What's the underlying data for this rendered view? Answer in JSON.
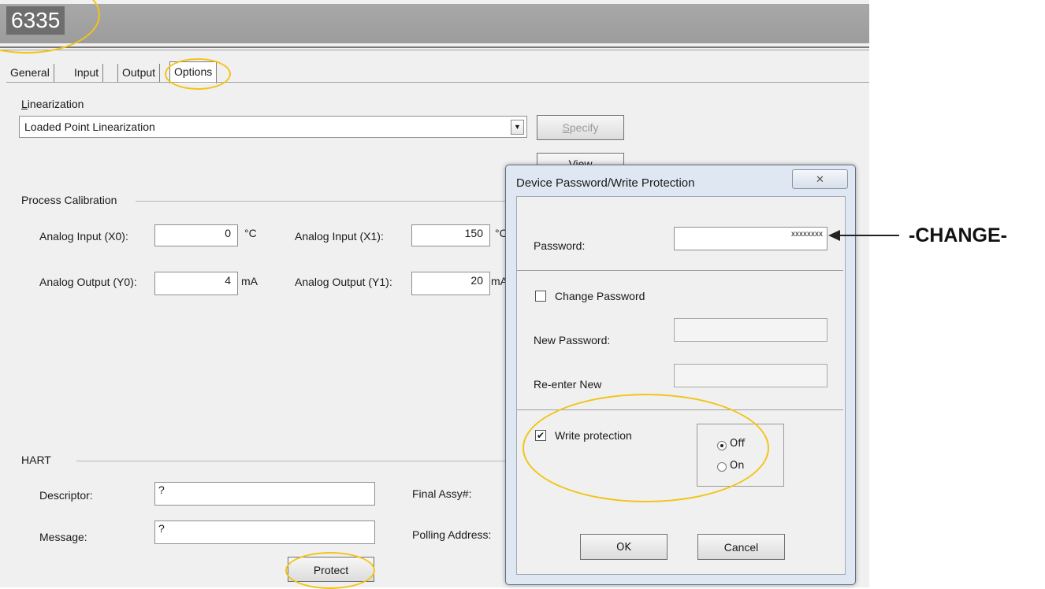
{
  "window": {
    "title": "6335"
  },
  "tabs": [
    {
      "label": "General"
    },
    {
      "label": "Input"
    },
    {
      "label": "Output"
    },
    {
      "label": "Options",
      "active": true
    }
  ],
  "linearization": {
    "label": "Linearization",
    "selected": "Loaded Point Linearization",
    "specify_label": "Specify",
    "view_label": "View"
  },
  "process_calibration": {
    "label": "Process Calibration",
    "analog_input_x0": {
      "label": "Analog Input (X0):",
      "value": "0",
      "unit": "°C"
    },
    "analog_input_x1": {
      "label": "Analog Input (X1):",
      "value": "150",
      "unit": "°C"
    },
    "analog_output_y0": {
      "label": "Analog Output (Y0):",
      "value": "4",
      "unit": "mA"
    },
    "analog_output_y1": {
      "label": "Analog Output (Y1):",
      "value": "20",
      "unit": "mA"
    }
  },
  "hart": {
    "label": "HART",
    "descriptor_label": "Descriptor:",
    "descriptor_value": "?",
    "message_label": "Message:",
    "message_value": "?",
    "final_assy_label": "Final Assy#:",
    "polling_address_label": "Polling Address:",
    "protect_label": "Protect"
  },
  "dialog": {
    "title": "Device Password/Write Protection",
    "close_glyph": "✕",
    "password_label": "Password:",
    "password_value": "xxxxxxxx",
    "change_password_label": "Change Password",
    "change_password_checked": false,
    "new_password_label": "New Password:",
    "reenter_label": "Re-enter New",
    "write_protection_label": "Write protection",
    "write_protection_checked": true,
    "radio_off_label": "Off",
    "radio_on_label": "On",
    "radio_selected": "Off",
    "ok_label": "OK",
    "cancel_label": "Cancel"
  },
  "annotation": {
    "text": "-CHANGE-"
  },
  "colors": {
    "highlight": "#f2c417",
    "titlebar": "#a3a3a3",
    "dialog_frame": "#dfe8f2"
  },
  "icons": {
    "checkbox_checked": "check-icon",
    "dropdown": "chevron-down-icon",
    "arrow": "left-arrow-icon"
  }
}
